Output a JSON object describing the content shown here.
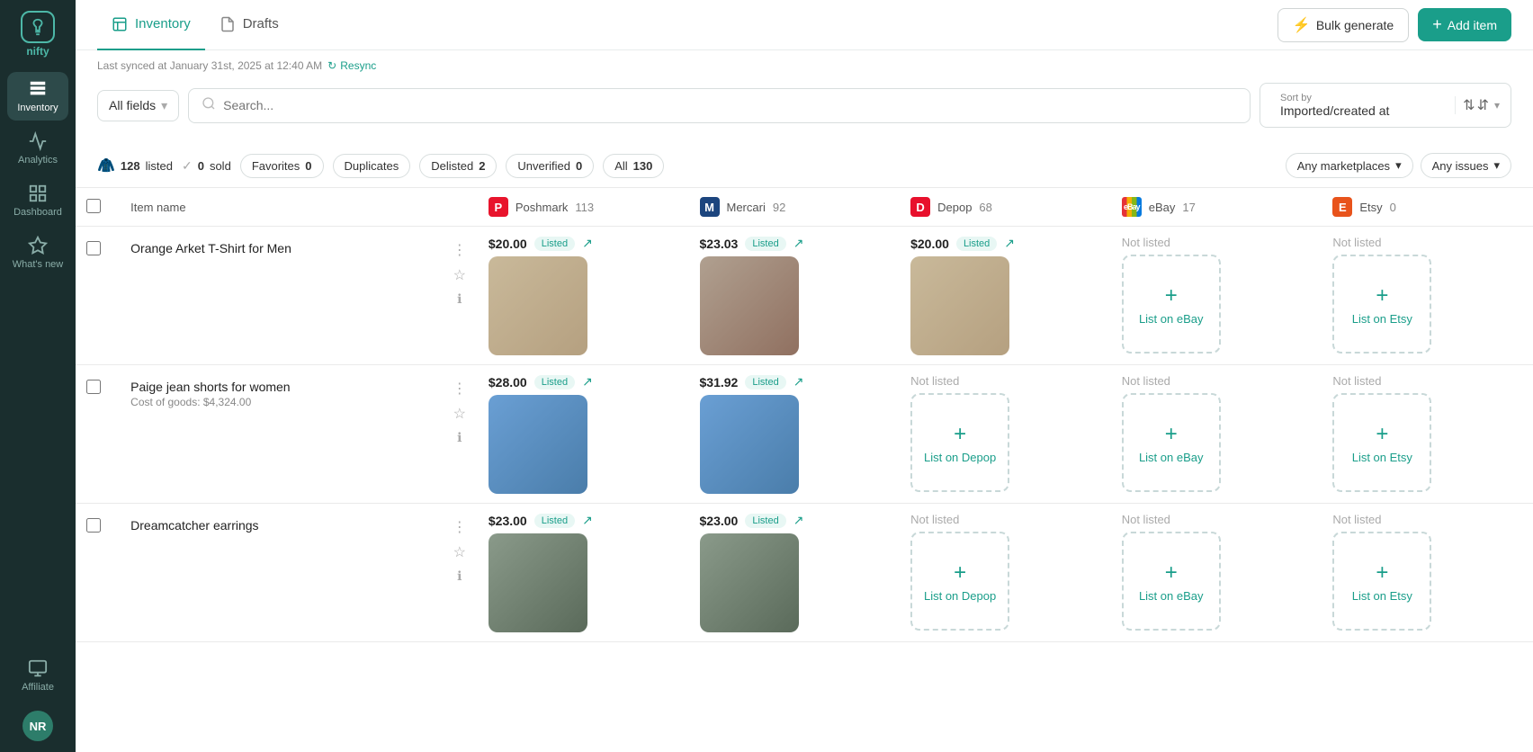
{
  "sidebar": {
    "logo_text": "nifty",
    "items": [
      {
        "id": "inventory",
        "label": "Inventory",
        "active": true
      },
      {
        "id": "analytics",
        "label": "Analytics",
        "active": false
      },
      {
        "id": "dashboard",
        "label": "Dashboard",
        "active": false
      },
      {
        "id": "whats-new",
        "label": "What's new",
        "active": false
      },
      {
        "id": "affiliate",
        "label": "Affiliate",
        "active": false
      }
    ],
    "avatar_initials": "NR"
  },
  "header": {
    "tabs": [
      {
        "id": "inventory",
        "label": "Inventory",
        "active": true
      },
      {
        "id": "drafts",
        "label": "Drafts",
        "active": false
      }
    ],
    "bulk_generate_label": "Bulk generate",
    "add_item_label": "Add item"
  },
  "toolbar": {
    "sync_text": "Last synced at January 31st, 2025 at 12:40 AM",
    "resync_label": "Resync",
    "filter_label": "All fields",
    "search_placeholder": "Search...",
    "sort_by_label": "Sort by",
    "sort_by_value": "Imported/created at"
  },
  "status_bar": {
    "listed_count": "128",
    "listed_label": "listed",
    "sold_count": "0",
    "sold_label": "sold",
    "filters": [
      {
        "id": "favorites",
        "label": "Favorites",
        "count": "0"
      },
      {
        "id": "duplicates",
        "label": "Duplicates",
        "count": ""
      },
      {
        "id": "delisted",
        "label": "Delisted",
        "count": "2"
      },
      {
        "id": "unverified",
        "label": "Unverified",
        "count": "0"
      },
      {
        "id": "all",
        "label": "All",
        "count": "130"
      }
    ],
    "marketplace_filter": "Any marketplaces",
    "issues_filter": "Any issues"
  },
  "table": {
    "headers": {
      "item_name": "Item name",
      "poshmark": {
        "name": "Poshmark",
        "count": "113"
      },
      "mercari": {
        "name": "Mercari",
        "count": "92"
      },
      "depop": {
        "name": "Depop",
        "count": "68"
      },
      "ebay": {
        "name": "eBay",
        "count": "17"
      },
      "etsy": {
        "name": "Etsy",
        "count": "0"
      }
    },
    "rows": [
      {
        "id": "row-1",
        "name": "Orange Arket T-Shirt for Men",
        "sub": "",
        "poshmark": {
          "price": "$20.00",
          "status": "Listed",
          "has_image": true,
          "img_class": "img-tshirt"
        },
        "mercari": {
          "price": "$23.03",
          "status": "Listed",
          "has_image": true,
          "img_class": "img-tshirt-dark"
        },
        "depop": {
          "price": "$20.00",
          "status": "Listed",
          "has_image": true,
          "img_class": "img-tshirt"
        },
        "ebay": {
          "price": "",
          "status": "Not listed",
          "has_image": false,
          "list_label": "List on eBay"
        },
        "etsy": {
          "price": "",
          "status": "Not listed",
          "has_image": false,
          "list_label": "List on Etsy"
        }
      },
      {
        "id": "row-2",
        "name": "Paige jean shorts for women",
        "sub": "Cost of goods: $4,324.00",
        "poshmark": {
          "price": "$28.00",
          "status": "Listed",
          "has_image": true,
          "img_class": "img-shorts"
        },
        "mercari": {
          "price": "$31.92",
          "status": "Listed",
          "has_image": true,
          "img_class": "img-shorts"
        },
        "depop": {
          "price": "",
          "status": "Not listed",
          "has_image": false,
          "list_label": "List on Depop"
        },
        "ebay": {
          "price": "",
          "status": "Not listed",
          "has_image": false,
          "list_label": "List on eBay"
        },
        "etsy": {
          "price": "",
          "status": "Not listed",
          "has_image": false,
          "list_label": "List on Etsy"
        }
      },
      {
        "id": "row-3",
        "name": "Dreamcatcher earrings",
        "sub": "",
        "poshmark": {
          "price": "$23.00",
          "status": "Listed",
          "has_image": true,
          "img_class": "img-earrings"
        },
        "mercari": {
          "price": "$23.00",
          "status": "Listed",
          "has_image": true,
          "img_class": "img-earrings"
        },
        "depop": {
          "price": "",
          "status": "Not listed",
          "has_image": false,
          "list_label": "List on Depop"
        },
        "ebay": {
          "price": "",
          "status": "Not listed",
          "has_image": false,
          "list_label": "List on eBay"
        },
        "etsy": {
          "price": "",
          "status": "Not listed",
          "has_image": false,
          "list_label": "List on Etsy"
        }
      }
    ]
  }
}
